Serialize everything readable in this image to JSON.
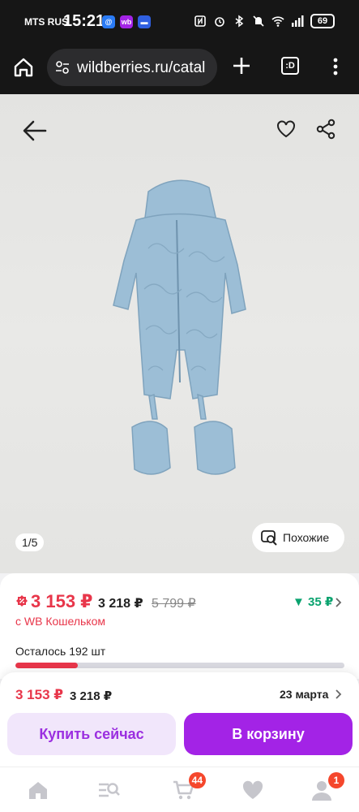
{
  "status_bar": {
    "carrier": "MTS RUS",
    "time": "15:21",
    "apps": [
      {
        "label": "@",
        "color": "#2a7bf5"
      },
      {
        "label": "wb",
        "color": "#a323e6"
      },
      {
        "label": "▬",
        "color": "#2f5fe0"
      }
    ],
    "battery": "69"
  },
  "browser": {
    "url": "wildberries.ru/catal",
    "tabs_label": ":D"
  },
  "gallery": {
    "counter": "1/5",
    "similar_label": "Похожие",
    "product_color": "#9cbed6"
  },
  "price": {
    "main": "3 153 ₽",
    "regular": "3 218 ₽",
    "old": "5 799 ₽",
    "cashback": "▼ 35 ₽",
    "wallet_note": "с WB Кошельком",
    "stock_text": "Осталось 192 шт",
    "stock_progress": 0.19
  },
  "buy_panel": {
    "price": "3 153 ₽",
    "regular": "3 218 ₽",
    "delivery_date": "23 марта",
    "buy_now_label": "Купить сейчас",
    "add_to_cart_label": "В корзину"
  },
  "bottom_nav": {
    "items": [
      {
        "name": "home-icon"
      },
      {
        "name": "catalog-search-icon"
      },
      {
        "name": "cart-icon",
        "badge": "44"
      },
      {
        "name": "favorites-heart-icon"
      },
      {
        "name": "profile-icon",
        "badge": "1"
      }
    ]
  },
  "colors": {
    "accent": "#a323e6",
    "price_red": "#e8364a",
    "cashback_green": "#0aa36f"
  }
}
